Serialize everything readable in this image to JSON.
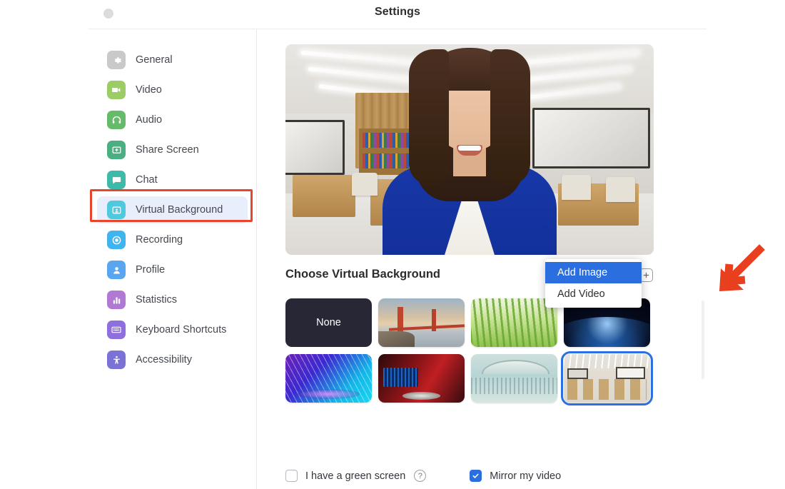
{
  "window": {
    "title": "Settings",
    "close_button": "close"
  },
  "sidebar": {
    "items": [
      {
        "label": "General",
        "icon": "gear-icon",
        "color": "#c9c9c9",
        "active": false
      },
      {
        "label": "Video",
        "icon": "video-camera-icon",
        "color": "#9ccc65",
        "active": false
      },
      {
        "label": "Audio",
        "icon": "headphones-icon",
        "color": "#66bb6a",
        "active": false
      },
      {
        "label": "Share Screen",
        "icon": "share-screen-icon",
        "color": "#4caf82",
        "active": false
      },
      {
        "label": "Chat",
        "icon": "chat-bubble-icon",
        "color": "#3fb9a8",
        "active": false
      },
      {
        "label": "Virtual Background",
        "icon": "virtual-background-icon",
        "color": "#4ec9e0",
        "active": true
      },
      {
        "label": "Recording",
        "icon": "record-icon",
        "color": "#40b4ee",
        "active": false
      },
      {
        "label": "Profile",
        "icon": "person-icon",
        "color": "#5aa5f0",
        "active": false
      },
      {
        "label": "Statistics",
        "icon": "bar-chart-icon",
        "color": "#b07ad4",
        "active": false
      },
      {
        "label": "Keyboard Shortcuts",
        "icon": "keyboard-icon",
        "color": "#8d6fdd",
        "active": false
      },
      {
        "label": "Accessibility",
        "icon": "accessibility-icon",
        "color": "#7b72d6",
        "active": false
      }
    ]
  },
  "preview": {
    "alt": "video-preview-woman-in-blue-blazer-with-library-background"
  },
  "section": {
    "title": "Choose Virtual Background",
    "add_button_label": "+"
  },
  "thumbnails": [
    {
      "name": "none",
      "label": "None",
      "art": "none",
      "selected": false
    },
    {
      "name": "bridge",
      "label": "",
      "art": "bridge",
      "selected": false
    },
    {
      "name": "grass",
      "label": "",
      "art": "grass",
      "selected": false
    },
    {
      "name": "earth",
      "label": "",
      "art": "earth",
      "selected": false
    },
    {
      "name": "stage",
      "label": "",
      "art": "stage",
      "selected": false
    },
    {
      "name": "newsroom",
      "label": "",
      "art": "newsroom",
      "selected": false
    },
    {
      "name": "arena",
      "label": "",
      "art": "arena",
      "selected": false
    },
    {
      "name": "library",
      "label": "",
      "art": "library",
      "selected": true
    }
  ],
  "dropdown": {
    "items": [
      {
        "label": "Add Image",
        "highlighted": true
      },
      {
        "label": "Add Video",
        "highlighted": false
      }
    ]
  },
  "bottom_options": [
    {
      "label": "I have a green screen",
      "checked": false,
      "has_help": true
    },
    {
      "label": "Mirror my video",
      "checked": true,
      "has_help": false
    }
  ],
  "colors": {
    "accent_blue": "#2a6ee0",
    "annotation_red": "#e8452c",
    "selection_border": "#2b6fe0",
    "active_nav_bg": "#e8eefc"
  }
}
